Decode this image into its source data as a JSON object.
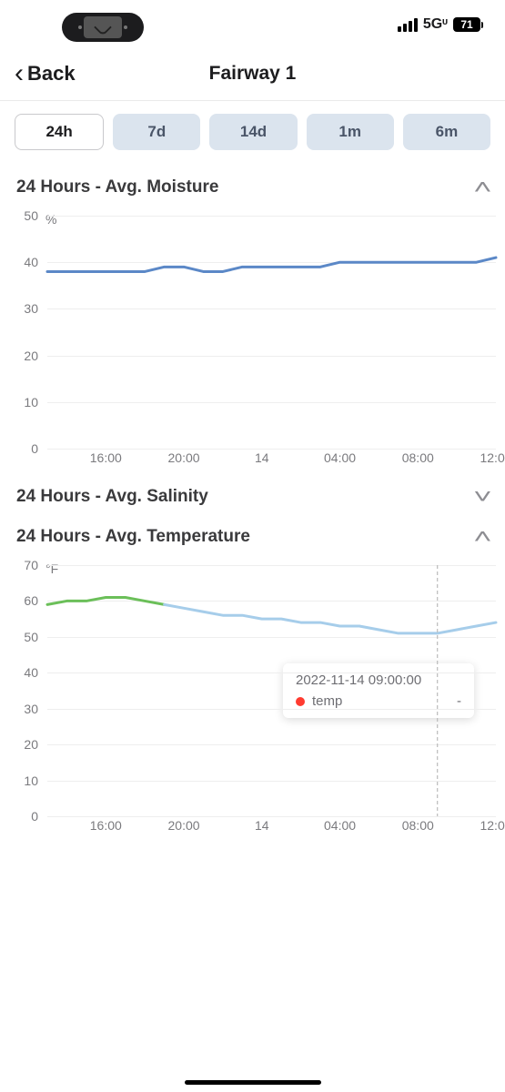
{
  "status_bar": {
    "network": "5Gᶸ",
    "battery": "71"
  },
  "nav": {
    "back": "Back",
    "title": "Fairway 1"
  },
  "tabs": {
    "items": [
      "24h",
      "7d",
      "14d",
      "1m",
      "6m"
    ],
    "active": 0
  },
  "sections": {
    "moisture": {
      "title": "24 Hours - Avg. Moisture",
      "expanded": true,
      "unit": "%"
    },
    "salinity": {
      "title": "24 Hours - Avg. Salinity",
      "expanded": false
    },
    "temperature": {
      "title": "24 Hours - Avg. Temperature",
      "expanded": true,
      "unit": "°F"
    }
  },
  "tooltip": {
    "timestamp": "2022-11-14 09:00:00",
    "series_label": "temp",
    "series_color": "#ff3b30",
    "value": "-"
  },
  "chart_data": [
    {
      "type": "line",
      "title": "24 Hours - Avg. Moisture",
      "ylabel": "%",
      "ylim": [
        0,
        50
      ],
      "yticks": [
        0,
        10,
        20,
        30,
        40,
        50
      ],
      "x": [
        "13:00",
        "14:00",
        "15:00",
        "16:00",
        "17:00",
        "18:00",
        "19:00",
        "20:00",
        "21:00",
        "22:00",
        "23:00",
        "14",
        "01:00",
        "02:00",
        "03:00",
        "04:00",
        "05:00",
        "06:00",
        "07:00",
        "08:00",
        "09:00",
        "10:00",
        "11:00",
        "12:00"
      ],
      "xticks_shown": [
        "16:00",
        "20:00",
        "14",
        "04:00",
        "08:00",
        "12:00"
      ],
      "series": [
        {
          "name": "moisture",
          "color": "#5b88c7",
          "values": [
            38,
            38,
            38,
            38,
            38,
            38,
            39,
            39,
            38,
            38,
            39,
            39,
            39,
            39,
            39,
            40,
            40,
            40,
            40,
            40,
            40,
            40,
            40,
            41
          ]
        }
      ]
    },
    {
      "type": "line",
      "title": "24 Hours - Avg. Temperature",
      "ylabel": "°F",
      "ylim": [
        0,
        70
      ],
      "yticks": [
        0,
        10,
        20,
        30,
        40,
        50,
        60,
        70
      ],
      "x": [
        "13:00",
        "14:00",
        "15:00",
        "16:00",
        "17:00",
        "18:00",
        "19:00",
        "20:00",
        "21:00",
        "22:00",
        "23:00",
        "14",
        "01:00",
        "02:00",
        "03:00",
        "04:00",
        "05:00",
        "06:00",
        "07:00",
        "08:00",
        "09:00",
        "10:00",
        "11:00",
        "12:00"
      ],
      "xticks_shown": [
        "16:00",
        "20:00",
        "14",
        "04:00",
        "08:00",
        "12:00"
      ],
      "crosshair_x": "09:00",
      "series": [
        {
          "name": "temp",
          "color": "#a6cdea",
          "values": [
            59,
            60,
            60,
            61,
            61,
            60,
            59,
            58,
            57,
            56,
            56,
            55,
            55,
            54,
            54,
            53,
            53,
            52,
            51,
            51,
            51,
            52,
            53,
            54
          ],
          "segment_colors": [
            {
              "from": 0,
              "to": 6,
              "color": "#6bbf59"
            },
            {
              "from": 6,
              "to": 23,
              "color": "#a6cdea"
            }
          ]
        }
      ]
    }
  ]
}
